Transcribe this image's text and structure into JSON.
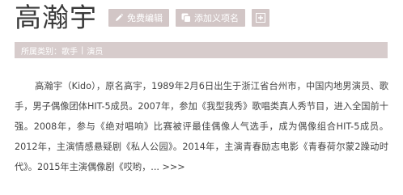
{
  "header": {
    "title": "高瀚宇",
    "buttons": {
      "edit_label": "免费编辑",
      "add_meaning_label": "添加义项名",
      "expand_symbol": "+"
    }
  },
  "category": {
    "label": "所属类别：",
    "items": [
      "歌手",
      "演员"
    ],
    "separator": "|"
  },
  "summary": {
    "text": "高瀚宇（Kido），原名高宇，1989年2月6日出生于浙江省台州市，中国内地男演员、歌手，男子偶像团体HIT-5成员。2007年，参加《我型我秀》歌唱类真人秀节目，进入全国前十强。2008年，参与《绝对唱响》比赛被评最佳偶像人气选手，成为偶像组合HIT-5成员。2012年，主演情感悬疑剧《私人公园》。2014年，主演青春励志电影《青春荷尔蒙2躁动时代》。2015年主演偶像剧《哎哟，...",
    "more_label": ">>>"
  },
  "colors": {
    "button_bg": "#d2c6c6",
    "bar_bg": "#d7cccc",
    "title_text": "#3a3a3a",
    "body_text": "#444444"
  },
  "icons": {
    "edit": "pencil-icon",
    "add": "add-meaning-icon"
  }
}
